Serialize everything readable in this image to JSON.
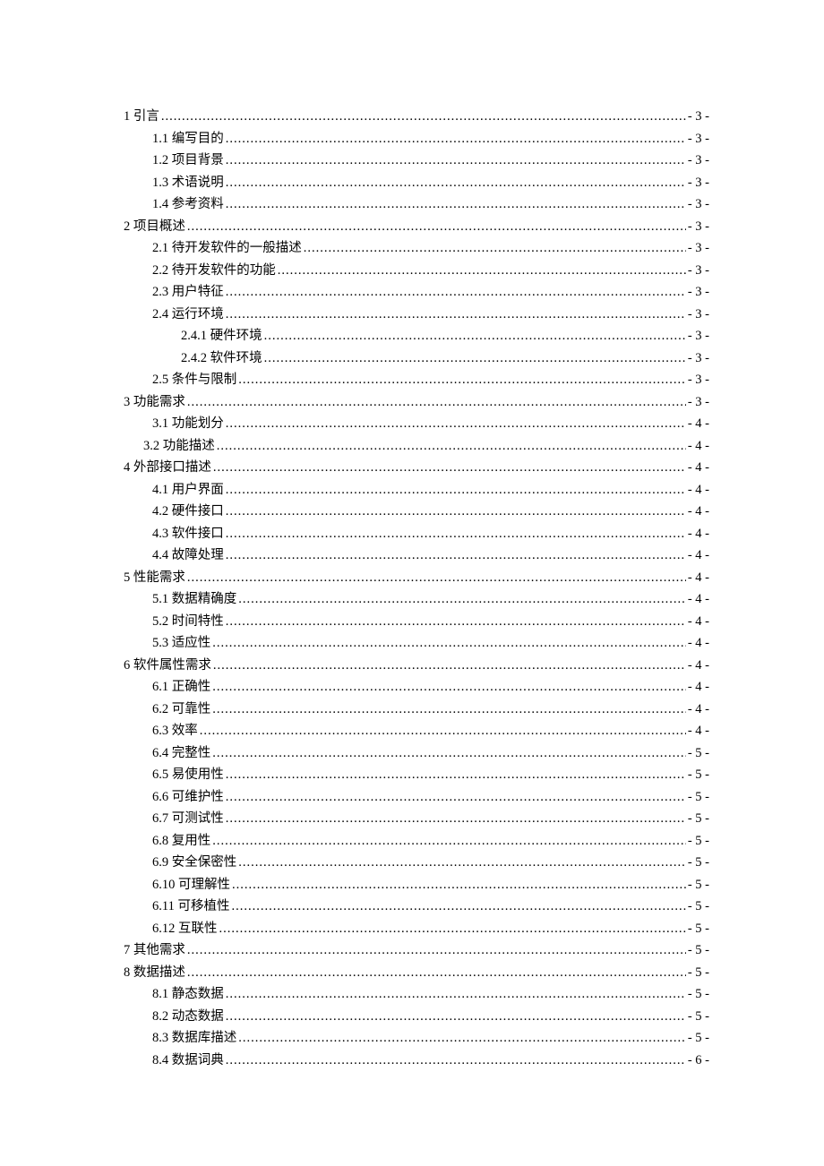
{
  "toc": [
    {
      "level": 1,
      "label": "1  引言",
      "page": "- 3 -"
    },
    {
      "level": 2,
      "label": "1.1  编写目的",
      "page": "- 3 -"
    },
    {
      "level": 2,
      "label": "1.2  项目背景",
      "page": "- 3 -"
    },
    {
      "level": 2,
      "label": "1.3  术语说明",
      "page": "- 3 -"
    },
    {
      "level": 2,
      "label": "1.4  参考资料",
      "page": "- 3 -"
    },
    {
      "level": 1,
      "label": "2  项目概述",
      "page": "- 3 -"
    },
    {
      "level": 2,
      "label": "2.1  待开发软件的一般描述",
      "page": "- 3 -"
    },
    {
      "level": 2,
      "label": "2.2  待开发软件的功能",
      "page": "- 3 -"
    },
    {
      "level": 2,
      "label": "2.3  用户特征",
      "page": "- 3 -"
    },
    {
      "level": 2,
      "label": "2.4  运行环境",
      "page": "- 3 -"
    },
    {
      "level": 3,
      "label": "2.4.1  硬件环境",
      "page": "- 3 -"
    },
    {
      "level": 3,
      "label": "2.4.2  软件环境",
      "page": "- 3 -"
    },
    {
      "level": 2,
      "label": "2.5 条件与限制",
      "page": "- 3 -"
    },
    {
      "level": 1,
      "label": "3 功能需求",
      "page": "- 3 -"
    },
    {
      "level": 2,
      "label": "3.1 功能划分",
      "page": "- 4 -"
    },
    {
      "level": "1a",
      "label": "3.2  功能描述",
      "page": "- 4 -"
    },
    {
      "level": 1,
      "label": "4  外部接口描述",
      "page": "- 4 -"
    },
    {
      "level": 2,
      "label": "4.1 用户界面",
      "page": "- 4 -"
    },
    {
      "level": 2,
      "label": "4.2 硬件接口",
      "page": "- 4 -"
    },
    {
      "level": 2,
      "label": "4.3 软件接口",
      "page": "- 4 -"
    },
    {
      "level": 2,
      "label": "4.4 故障处理",
      "page": "- 4 -"
    },
    {
      "level": 1,
      "label": "5  性能需求",
      "page": "- 4 -"
    },
    {
      "level": 2,
      "label": "5.1  数据精确度",
      "page": "- 4 -"
    },
    {
      "level": 2,
      "label": "5.2  时间特性",
      "page": "- 4 -"
    },
    {
      "level": 2,
      "label": "5.3  适应性",
      "page": "- 4 -"
    },
    {
      "level": 1,
      "label": "6  软件属性需求",
      "page": "- 4 -"
    },
    {
      "level": 2,
      "label": "6.1  正确性",
      "page": "- 4 -"
    },
    {
      "level": 2,
      "label": "6.2  可靠性",
      "page": "- 4 -"
    },
    {
      "level": 2,
      "label": "6.3  效率",
      "page": "- 4 -"
    },
    {
      "level": 2,
      "label": "6.4  完整性",
      "page": "- 5 -"
    },
    {
      "level": 2,
      "label": "6.5  易使用性",
      "page": "- 5 -"
    },
    {
      "level": 2,
      "label": "6.6  可维护性",
      "page": "- 5 -"
    },
    {
      "level": 2,
      "label": "6.7  可测试性",
      "page": "- 5 -"
    },
    {
      "level": 2,
      "label": "6.8  复用性",
      "page": "- 5 -"
    },
    {
      "level": 2,
      "label": "6.9  安全保密性",
      "page": "- 5 -"
    },
    {
      "level": 2,
      "label": "6.10  可理解性",
      "page": "- 5 -"
    },
    {
      "level": 2,
      "label": "6.11  可移植性",
      "page": "- 5 -"
    },
    {
      "level": 2,
      "label": "6.12  互联性",
      "page": "- 5 -"
    },
    {
      "level": 1,
      "label": "7 其他需求",
      "page": "- 5 -"
    },
    {
      "level": 1,
      "label": "8  数据描述",
      "page": "- 5 -"
    },
    {
      "level": 2,
      "label": "8.1  静态数据",
      "page": "- 5 -"
    },
    {
      "level": 2,
      "label": "8.2  动态数据",
      "page": "- 5 -"
    },
    {
      "level": 2,
      "label": "8.3  数据库描述",
      "page": "- 5 -"
    },
    {
      "level": 2,
      "label": "8.4  数据词典",
      "page": "- 6 -"
    }
  ]
}
